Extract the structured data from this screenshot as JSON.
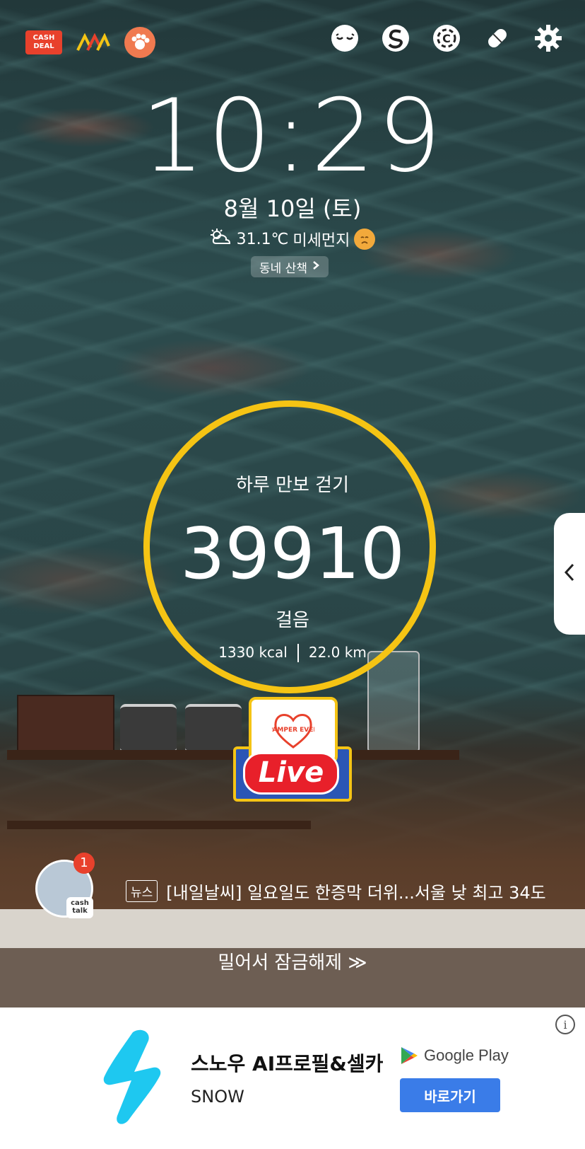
{
  "top_left": {
    "cash_deal_line1": "CASH",
    "cash_deal_line2": "DEAL"
  },
  "icons": [
    "cash-deal-icon",
    "ml-logo-icon",
    "paw-icon",
    "sleepy-face-icon",
    "s-logo-icon",
    "c-chip-icon",
    "pill-icon",
    "gear-icon"
  ],
  "clock": {
    "time": "10:29",
    "date": "8월 10일 (토)"
  },
  "weather": {
    "temperature": "31.1℃",
    "dust_label": "미세먼지"
  },
  "walk_pill": {
    "label": "동네 산책"
  },
  "pedometer": {
    "title": "하루 만보 걷기",
    "steps": "39910",
    "unit": "걸음",
    "kcal": "1330 kcal",
    "distance": "22.0 km",
    "ring_color": "#f5c414"
  },
  "live_event": {
    "brand": "PAMPER EVER",
    "label": "Live"
  },
  "cashtalk": {
    "badge_count": "1",
    "label_line1": "cash",
    "label_line2": "talk"
  },
  "news": {
    "tag": "뉴스",
    "headline": "[내일날씨] 일요일도 한증막 더위...서울 낮 최고 34도"
  },
  "unlock": {
    "label": "밀어서 잠금해제 ≫"
  },
  "ad": {
    "title": "스노우 AI프로필&셀카",
    "subtitle": "SNOW",
    "store": "Google Play",
    "button": "바로가기",
    "info": "i",
    "logo_color": "#1ec8f0",
    "button_color": "#3a7ce8"
  }
}
